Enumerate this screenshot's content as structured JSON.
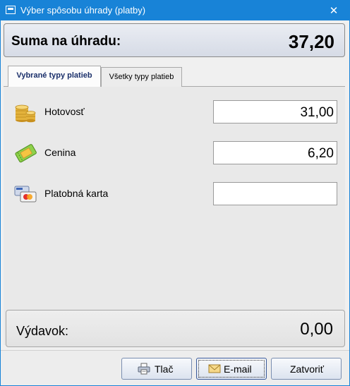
{
  "window": {
    "title": "Výber spôsobu úhrady (platby)",
    "close_glyph": "✕"
  },
  "summary": {
    "label": "Suma na úhradu:",
    "value": "37,20"
  },
  "tabs": [
    {
      "label": "Vybrané typy platieb",
      "active": true
    },
    {
      "label": "Všetky typy platieb",
      "active": false
    }
  ],
  "payments": [
    {
      "label": "Hotovosť",
      "value": "31,00",
      "icon": "coins-icon"
    },
    {
      "label": "Cenina",
      "value": "6,20",
      "icon": "voucher-icon"
    },
    {
      "label": "Platobná karta",
      "value": "",
      "icon": "credit-card-icon"
    }
  ],
  "change": {
    "label": "Výdavok:",
    "value": "0,00"
  },
  "buttons": {
    "print": {
      "label": "Tlač",
      "icon": "printer-icon"
    },
    "email": {
      "label": "E-mail",
      "icon": "envelope-icon"
    },
    "close": {
      "label": "Zatvoriť"
    }
  },
  "colors": {
    "titlebar": "#1883d7",
    "tab_active_text": "#1a2f6a"
  }
}
